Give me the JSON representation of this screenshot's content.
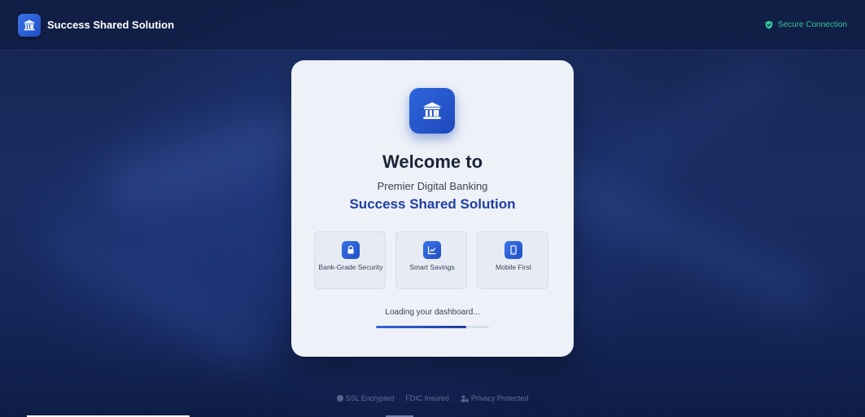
{
  "header": {
    "brand_title": "Success Shared Solution",
    "brand_icon": "bank-icon",
    "secure_label": "Secure Connection",
    "secure_icon": "shield-icon"
  },
  "card": {
    "logo_icon": "bank-icon",
    "welcome": "Welcome to",
    "subtitle": "Premier Digital Banking",
    "bank_name": "Success Shared Solution",
    "features": [
      {
        "label": "Bank-Grade Security",
        "icon": "lock-icon"
      },
      {
        "label": "Smart Savings",
        "icon": "chart-icon"
      },
      {
        "label": "Mobile First",
        "icon": "mobile-icon"
      }
    ],
    "loading_text": "Loading your dashboard...",
    "progress": 0.8
  },
  "footer": {
    "items": [
      {
        "label": "SSL Encrypted",
        "icon": "dot-icon"
      },
      {
        "label": "FDIC Insured",
        "icon": ""
      },
      {
        "label": "Privacy Protected",
        "icon": "user-lock-icon"
      }
    ]
  },
  "colors": {
    "accent": "#2f66dc",
    "brand_text": "#1e3fa5",
    "secure": "#34c39a"
  }
}
